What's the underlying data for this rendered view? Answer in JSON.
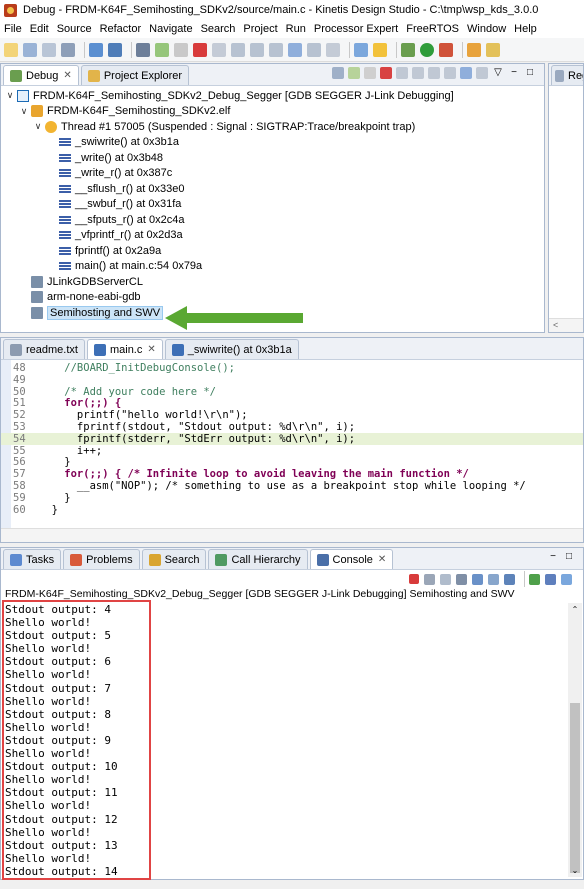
{
  "window": {
    "title": "Debug - FRDM-K64F_Semihosting_SDKv2/source/main.c - Kinetis Design Studio - C:\\tmp\\wsp_kds_3.0.0"
  },
  "menu": [
    "File",
    "Edit",
    "Source",
    "Refactor",
    "Navigate",
    "Search",
    "Project",
    "Run",
    "Processor Expert",
    "FreeRTOS",
    "Window",
    "Help"
  ],
  "debug_panel": {
    "tabs": [
      {
        "label": "Debug",
        "icon": "debug-icon",
        "active": true,
        "close": "✕"
      },
      {
        "label": "Project Explorer",
        "icon": "project-explorer-icon",
        "active": false
      }
    ],
    "tree": [
      {
        "indent": 0,
        "chevron": "∨",
        "icon": "launch-config-icon",
        "label": "FRDM-K64F_Semihosting_SDKv2_Debug_Segger [GDB SEGGER J-Link Debugging]"
      },
      {
        "indent": 1,
        "chevron": "∨",
        "icon": "elf-icon",
        "label": "FRDM-K64F_Semihosting_SDKv2.elf"
      },
      {
        "indent": 2,
        "chevron": "∨",
        "icon": "thread-icon",
        "label": "Thread #1 57005 (Suspended : Signal : SIGTRAP:Trace/breakpoint trap)"
      },
      {
        "indent": 3,
        "chevron": "",
        "icon": "stack-frame-icon",
        "label": "_swiwrite() at 0x3b1a"
      },
      {
        "indent": 3,
        "chevron": "",
        "icon": "stack-frame-icon",
        "label": "_write() at 0x3b48"
      },
      {
        "indent": 3,
        "chevron": "",
        "icon": "stack-frame-icon",
        "label": "_write_r() at 0x387c"
      },
      {
        "indent": 3,
        "chevron": "",
        "icon": "stack-frame-icon",
        "label": "__sflush_r() at 0x33e0"
      },
      {
        "indent": 3,
        "chevron": "",
        "icon": "stack-frame-icon",
        "label": "__swbuf_r() at 0x31fa"
      },
      {
        "indent": 3,
        "chevron": "",
        "icon": "stack-frame-icon",
        "label": "__sfputs_r() at 0x2c4a"
      },
      {
        "indent": 3,
        "chevron": "",
        "icon": "stack-frame-icon",
        "label": "_vfprintf_r() at 0x2d3a"
      },
      {
        "indent": 3,
        "chevron": "",
        "icon": "stack-frame-icon",
        "label": "fprintf() at 0x2a9a"
      },
      {
        "indent": 3,
        "chevron": "",
        "icon": "stack-frame-icon",
        "label": "main() at main.c:54 0x79a"
      },
      {
        "indent": 1,
        "chevron": "",
        "icon": "process-icon",
        "label": "JLinkGDBServerCL"
      },
      {
        "indent": 1,
        "chevron": "",
        "icon": "process-icon",
        "label": "arm-none-eabi-gdb"
      },
      {
        "indent": 1,
        "chevron": "",
        "icon": "process-icon",
        "label": "Semihosting and SWV",
        "selected": true
      }
    ]
  },
  "registers_tab": {
    "label": "Reg"
  },
  "editor": {
    "tabs": [
      {
        "label": "readme.txt",
        "icon": "text-file-icon",
        "active": false
      },
      {
        "label": "main.c",
        "icon": "c-file-icon",
        "active": true,
        "close": "✕"
      },
      {
        "label": "_swiwrite() at 0x3b1a",
        "icon": "c-file-icon",
        "active": false
      }
    ],
    "lines": [
      {
        "num": "48",
        "text": "    //BOARD_InitDebugConsole();",
        "type": "comment"
      },
      {
        "num": "49",
        "text": "",
        "type": "plain"
      },
      {
        "num": "50",
        "text": "    /* Add your code here */",
        "type": "comment"
      },
      {
        "num": "51",
        "text": "    for(;;) {",
        "type": "keyword"
      },
      {
        "num": "52",
        "text": "      printf(\"hello world!\\r\\n\");",
        "type": "call"
      },
      {
        "num": "53",
        "text": "      fprintf(stdout, \"Stdout output: %d\\r\\n\", i);",
        "type": "call"
      },
      {
        "num": "54",
        "text": "      fprintf(stderr, \"StdErr output: %d\\r\\n\", i);",
        "type": "call",
        "highlight": true
      },
      {
        "num": "55",
        "text": "      i++;",
        "type": "plain"
      },
      {
        "num": "56",
        "text": "    }",
        "type": "plain"
      },
      {
        "num": "57",
        "text": "    for(;;) { /* Infinite loop to avoid leaving the main function */",
        "type": "keyword"
      },
      {
        "num": "58",
        "text": "      __asm(\"NOP\"); /* something to use as a breakpoint stop while looping */",
        "type": "call"
      },
      {
        "num": "59",
        "text": "    }",
        "type": "plain"
      },
      {
        "num": "60",
        "text": "  }",
        "type": "plain"
      }
    ]
  },
  "console_panel": {
    "tabs": [
      {
        "label": "Tasks",
        "icon": "tasks-icon",
        "active": false
      },
      {
        "label": "Problems",
        "icon": "problems-icon",
        "active": false
      },
      {
        "label": "Search",
        "icon": "search-icon",
        "active": false
      },
      {
        "label": "Call Hierarchy",
        "icon": "call-hierarchy-icon",
        "active": false
      },
      {
        "label": "Console",
        "icon": "console-icon",
        "active": true,
        "close": "✕"
      }
    ],
    "title": "FRDM-K64F_Semihosting_SDKv2_Debug_Segger [GDB SEGGER J-Link Debugging] Semihosting and SWV",
    "lines": [
      "Stdout output: 4",
      "Shello world!",
      "Stdout output: 5",
      "Shello world!",
      "Stdout output: 6",
      "Shello world!",
      "Stdout output: 7",
      "Shello world!",
      "Stdout output: 8",
      "Shello world!",
      "Stdout output: 9",
      "Shello world!",
      "Stdout output: 10",
      "Shello world!",
      "Stdout output: 11",
      "Shello world!",
      "Stdout output: 12",
      "Shello world!",
      "Stdout output: 13",
      "Shello world!",
      "Stdout output: 14"
    ]
  },
  "colors": {
    "highlight_box": "#e04444",
    "arrow": "#5aa832",
    "current_line": "#e8f2d6"
  }
}
